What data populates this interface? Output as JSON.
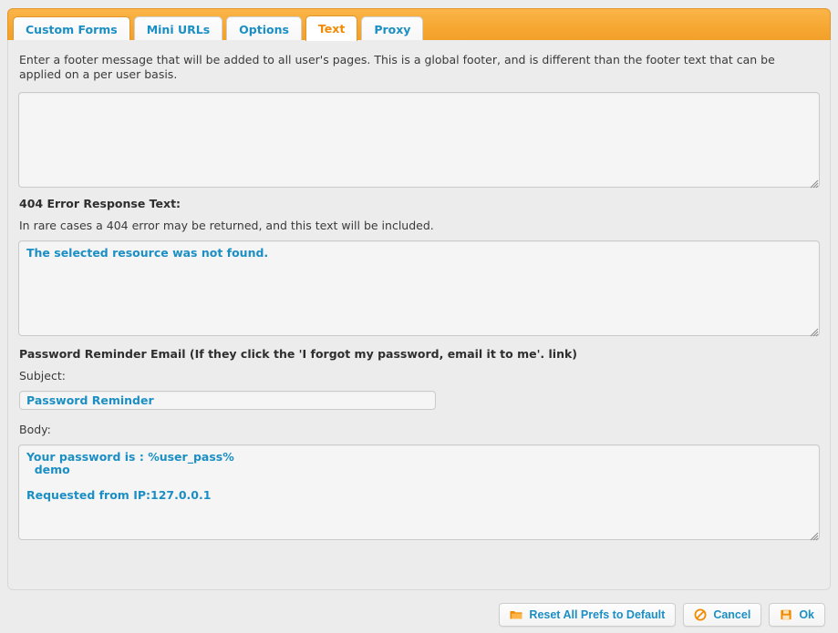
{
  "tabs": [
    {
      "label": "Custom Forms",
      "active": false
    },
    {
      "label": "Mini URLs",
      "active": false
    },
    {
      "label": "Options",
      "active": false
    },
    {
      "label": "Text",
      "active": true
    },
    {
      "label": "Proxy",
      "active": false
    }
  ],
  "main": {
    "footer_description": "Enter a footer message that will be added to all user's pages. This is a global footer, and is different than the footer text that can be applied on a per user basis.",
    "footer_textarea_value": "",
    "footer_textarea_placeholder": "",
    "error_404_label": "404 Error Response Text:",
    "error_404_description": "In rare cases a 404 error may be returned, and this text will be included.",
    "error_404_value": "The selected resource was not found.",
    "password_reminder_label": "Password Reminder Email (If they click the 'I forgot my password, email it to me'. link)",
    "subject_label": "Subject:",
    "subject_value": "Password Reminder",
    "body_label": "Body:",
    "body_value": "Your password is : %user_pass%\n  demo\n\nRequested from IP:127.0.0.1"
  },
  "footer_bar": {
    "reset_label": "Reset All Prefs to Default",
    "cancel_label": "Cancel",
    "ok_label": "Ok",
    "reset_icon": "folder-icon",
    "cancel_icon": "cancel-circle-icon",
    "ok_icon": "save-disk-icon"
  },
  "colors": {
    "accent_orange": "#f6a833",
    "link_blue": "#1b8fc4",
    "active_tab_text": "#f08a00",
    "panel_bg": "#ececec",
    "field_bg": "#f5f5f5",
    "field_border": "#cacaca"
  }
}
